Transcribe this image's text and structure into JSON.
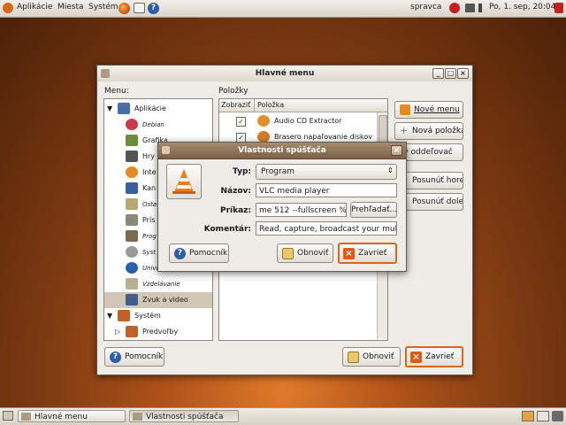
{
  "top_panel": {
    "menus": [
      "Aplikácie",
      "Miesta",
      "Systém"
    ],
    "user": "spravca",
    "clock": "Po, 1. sep, 20:04"
  },
  "main_window": {
    "title": "Hlavné menu",
    "menu_label": "Menu:",
    "items_label": "Položky",
    "col_show": "Zobraziť",
    "col_item": "Položka",
    "categories": [
      {
        "label": "Aplikácie",
        "level": 0,
        "icon": "applications-icon"
      },
      {
        "label": "Debian",
        "level": 1,
        "icon": "debian-icon",
        "hidden": true
      },
      {
        "label": "Grafika",
        "level": 1,
        "icon": "graphics-icon"
      },
      {
        "label": "Hry",
        "level": 1,
        "icon": "games-icon"
      },
      {
        "label": "Inte",
        "level": 1,
        "icon": "internet-icon"
      },
      {
        "label": "Kan",
        "level": 1,
        "icon": "office-icon"
      },
      {
        "label": "Osta",
        "level": 1,
        "icon": "other-icon",
        "hidden": true
      },
      {
        "label": "Prís",
        "level": 1,
        "icon": "accessories-icon"
      },
      {
        "label": "Prog",
        "level": 1,
        "icon": "programming-icon",
        "hidden": true
      },
      {
        "label": "Syst",
        "level": 1,
        "icon": "system-tools-icon",
        "hidden": true
      },
      {
        "label": "Unive",
        "level": 1,
        "icon": "universal-access-icon",
        "hidden": true
      },
      {
        "label": "Vzdelávanie",
        "level": 1,
        "icon": "education-icon",
        "hidden": true
      },
      {
        "label": "Zvuk a video",
        "level": 1,
        "icon": "sound-video-icon",
        "selected": true
      },
      {
        "label": "Systém",
        "level": 0,
        "icon": "system-icon"
      },
      {
        "label": "Predvoľby",
        "level": 1,
        "icon": "preferences-icon"
      }
    ],
    "items": [
      {
        "show": true,
        "label": "Audio CD Extractor"
      },
      {
        "show": true,
        "label": "Brasero napaľovanie diskov"
      }
    ],
    "side_buttons": {
      "new_menu": "Nové menu",
      "new_item": "Nová položka",
      "new_separator": "vý oddeľovač",
      "move_up": "Posunúť hore",
      "move_down": "Posunúť dole"
    },
    "help": "Pomocník",
    "revert": "Obnoviť",
    "close": "Zavrieť"
  },
  "dialog": {
    "title": "Vlastnosti spúšťača",
    "type_label": "Typ:",
    "type_value": "Program",
    "name_label": "Názov:",
    "name_value": "VLC media player",
    "command_label": "Príkaz:",
    "command_value": "me 512 --fullscreen %m",
    "browse": "Prehľadať...",
    "comment_label": "Komentár:",
    "comment_value": "Read, capture, broadcast your multime",
    "help": "Pomocník",
    "revert": "Obnoviť",
    "close": "Zavrieť"
  },
  "taskbar": {
    "tasks": [
      "Hlavné menu",
      "Vlastnosti spúšťača"
    ]
  },
  "colors": {
    "accent": "#d9661a",
    "title_active": "#8c7156",
    "selection": "#d2c7b4"
  }
}
